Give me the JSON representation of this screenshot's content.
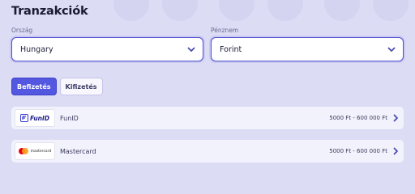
{
  "page": {
    "title": "Tranzakciók"
  },
  "filters": {
    "country": {
      "label": "Ország",
      "value": "Hungary"
    },
    "currency": {
      "label": "Pénznem",
      "value": "Forint"
    }
  },
  "tabs": [
    {
      "label": "Befizetés",
      "active": true
    },
    {
      "label": "Kifizetés",
      "active": false
    }
  ],
  "methods": [
    {
      "name": "FunID",
      "logo_text": "FunID",
      "range": "5000 Ft - 600 000 Ft"
    },
    {
      "name": "Mastercard",
      "logo_text": "mastercard",
      "range": "5000 Ft - 600 000 Ft"
    }
  ],
  "icons": {
    "select": "chevron-down-icon",
    "row": "chevron-right-icon"
  },
  "colors": {
    "accent": "#5458e0",
    "background": "#dcdcf5",
    "arrow": "#4a4ab0"
  }
}
